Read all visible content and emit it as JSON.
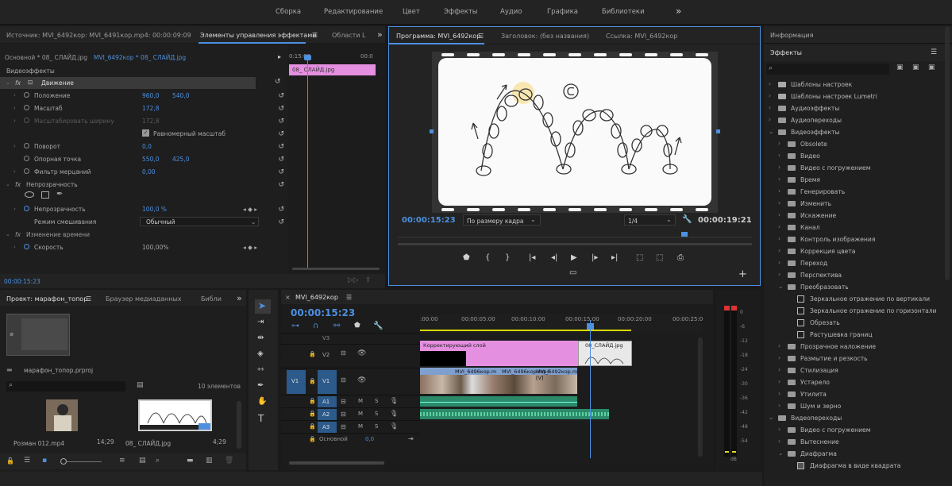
{
  "workspaces": [
    "Сборка",
    "Редактирование",
    "Цвет",
    "Эффекты",
    "Аудио",
    "Графика",
    "Библиотеки"
  ],
  "source_panel": {
    "tab_source": "Источник: MVI_6492кор: MVI_6491кор.mp4: 00:00:09:09",
    "tab_effect_controls": "Элементы управления эффектами",
    "tab_metadata": "Области L",
    "sequence_master": "Основной * 08_ СЛАЙД.jpg",
    "sequence_clip": "MVI_6492кор * 08_ СЛАЙД.jpg",
    "ruler_time": "0:15:00",
    "ruler_time2": "00:0",
    "clip_label": "08_ СЛАЙД.jpg",
    "video_effects": "Видеоэффекты",
    "motion": "Движение",
    "position_label": "Положение",
    "position_x": "960,0",
    "position_y": "540,0",
    "scale_label": "Масштаб",
    "scale_value": "172,8",
    "scale_width_label": "Масштабировать ширину",
    "scale_width_value": "172,8",
    "uniform_scale": "Равномерный масштаб",
    "rotation_label": "Поворот",
    "rotation_value": "0,0",
    "anchor_label": "Опорная точка",
    "anchor_x": "550,0",
    "anchor_y": "425,0",
    "flicker_label": "Фильтр мерцаний",
    "flicker_value": "0,00",
    "opacity": "Непрозрачность",
    "opacity_label": "Непрозрачность",
    "opacity_value": "100,0 %",
    "blend_label": "Режим смешивания",
    "blend_value": "Обычный",
    "time_remap": "Изменение времени",
    "speed_label": "Скорость",
    "speed_value": "100,00%",
    "timecode": "00:00:15:23"
  },
  "program_monitor": {
    "tab_program": "Программа: MVI_6492кор",
    "tab_title": "Заголовок: (без названия)",
    "tab_ref": "Ссылка: MVI_6492кор",
    "timecode_left": "00:00:15:23",
    "fit": "По размеру кадра",
    "resolution": "1/4",
    "timecode_right": "00:00:19:21",
    "playhead_fraction": 0.81
  },
  "right_panel": {
    "tab_info": "Информация",
    "tab_effects": "Эффекты",
    "items": [
      {
        "label": "Шаблоны настроек",
        "level": 0,
        "open": false,
        "icon": "preset"
      },
      {
        "label": "Шаблоны настроек Lumetri",
        "level": 0,
        "open": false,
        "icon": "preset"
      },
      {
        "label": "Аудиоэффекты",
        "level": 0,
        "open": false,
        "icon": "folder"
      },
      {
        "label": "Аудиопереходы",
        "level": 0,
        "open": false,
        "icon": "folder"
      },
      {
        "label": "Видеоэффекты",
        "level": 0,
        "open": true,
        "icon": "folder"
      },
      {
        "label": "Obsolete",
        "level": 1,
        "open": false,
        "icon": "folder"
      },
      {
        "label": "Видео",
        "level": 1,
        "open": false,
        "icon": "folder"
      },
      {
        "label": "Видео с погружением",
        "level": 1,
        "open": false,
        "icon": "folder"
      },
      {
        "label": "Время",
        "level": 1,
        "open": false,
        "icon": "folder"
      },
      {
        "label": "Генерировать",
        "level": 1,
        "open": false,
        "icon": "folder"
      },
      {
        "label": "Изменить",
        "level": 1,
        "open": false,
        "icon": "folder"
      },
      {
        "label": "Искажение",
        "level": 1,
        "open": false,
        "icon": "folder"
      },
      {
        "label": "Канал",
        "level": 1,
        "open": false,
        "icon": "folder"
      },
      {
        "label": "Контроль изображения",
        "level": 1,
        "open": false,
        "icon": "folder"
      },
      {
        "label": "Коррекция цвета",
        "level": 1,
        "open": false,
        "icon": "folder"
      },
      {
        "label": "Переход",
        "level": 1,
        "open": false,
        "icon": "folder"
      },
      {
        "label": "Перспектива",
        "level": 1,
        "open": false,
        "icon": "folder"
      },
      {
        "label": "Преобразовать",
        "level": 1,
        "open": true,
        "icon": "folder"
      },
      {
        "label": "Зеркальное отражение по вертикали",
        "level": 2,
        "open": null,
        "icon": "effect"
      },
      {
        "label": "Зеркальное отражение по горизонтали",
        "level": 2,
        "open": null,
        "icon": "effect"
      },
      {
        "label": "Обрезать",
        "level": 2,
        "open": null,
        "icon": "effect"
      },
      {
        "label": "Растушевка границ",
        "level": 2,
        "open": null,
        "icon": "effect"
      },
      {
        "label": "Прозрачное наложение",
        "level": 1,
        "open": false,
        "icon": "folder"
      },
      {
        "label": "Размытие и резкость",
        "level": 1,
        "open": false,
        "icon": "folder"
      },
      {
        "label": "Стилизация",
        "level": 1,
        "open": false,
        "icon": "folder"
      },
      {
        "label": "Устарело",
        "level": 1,
        "open": false,
        "icon": "folder"
      },
      {
        "label": "Утилита",
        "level": 1,
        "open": false,
        "icon": "folder"
      },
      {
        "label": "Шум и зерно",
        "level": 1,
        "open": false,
        "icon": "folder"
      },
      {
        "label": "Видеопереходы",
        "level": 0,
        "open": true,
        "icon": "folder"
      },
      {
        "label": "Видео с погружением",
        "level": 1,
        "open": false,
        "icon": "folder"
      },
      {
        "label": "Вытеснение",
        "level": 1,
        "open": false,
        "icon": "folder"
      },
      {
        "label": "Диафрагма",
        "level": 1,
        "open": true,
        "icon": "folder"
      },
      {
        "label": "Диафрагма в виде квадрата",
        "level": 2,
        "open": null,
        "icon": "transition"
      }
    ]
  },
  "project_panel": {
    "tab_project": "Проект: марафон_топор",
    "tab_browser": "Браузер медиаданных",
    "tab_lib": "Библи",
    "project_file": "марафон_топор.prproj",
    "count": "10 элементов",
    "item1_name": "Розман 012.mp4",
    "item1_dur": "14;29",
    "item2_name": "08_ СЛАЙД.jpg",
    "item2_dur": "4;29"
  },
  "timeline": {
    "tab": "MVI_6492кор",
    "timecode": "00:00:15:23",
    "ruler": [
      ":00:00",
      "00:00:05:00",
      "00:00:10:00",
      "00:00:15:00",
      "00:00:20:00",
      "00:00:25:0"
    ],
    "tracks": [
      "V3",
      "V2",
      "V1",
      "A1",
      "A2",
      "A3"
    ],
    "v1_src": "V1",
    "mute": "M",
    "solo": "S",
    "master_label": "Основной",
    "master_value": "0,0",
    "clip_adjust": "Корректирующий слой",
    "clip_slide": "08_СЛАЙД.jpg",
    "clip_v1a": "MVI_6496кор.m",
    "clip_v1b": "MVI_6496кор.mp4",
    "clip_v1c": "MVI_6492кор.mp4 [V]"
  },
  "meter": {
    "scale": [
      "0",
      "-6",
      "-12",
      "-18",
      "-24",
      "-30",
      "-36",
      "-42",
      "-48",
      "-54",
      "dB"
    ]
  }
}
